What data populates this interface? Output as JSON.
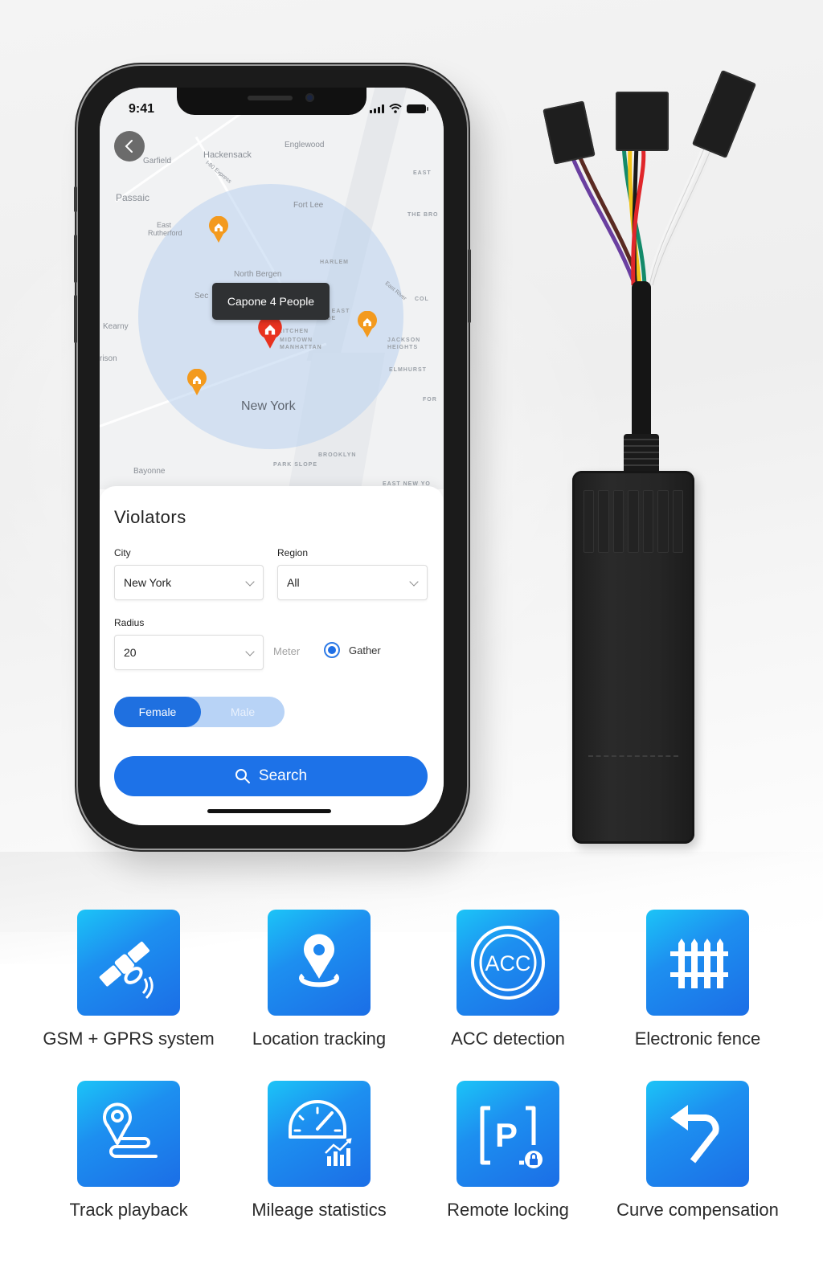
{
  "phone": {
    "status_bar": {
      "time": "9:41"
    },
    "map": {
      "labels": {
        "hackensack": "Hackensack",
        "englewood": "Englewood",
        "garfield": "Garfield",
        "express": "I-80 Express",
        "passaic": "Passaic",
        "fort_lee": "Fort Lee",
        "east": "EAST",
        "the_bronx": "THE BRO",
        "east_rutherford": "East Rutherford",
        "harlem": "HARLEM",
        "north_bergen": "North Bergen",
        "secaucus": "Sec",
        "east_river": "East River",
        "co": "COL",
        "kearny": "Kearny",
        "upper_east_side": "UPPER EAST SIDE",
        "hells_kitchen": "KITCHEN",
        "midtown": "MIDTOWN MANHATTAN",
        "jackson_heights": "JACKSON HEIGHTS",
        "harrison": "rison",
        "elmhurst": "ELMHURST",
        "new_york": "New York",
        "forest": "FOR",
        "brooklyn": "BROOKLYN",
        "park_slope": "PARK SLOPE",
        "bayonne": "Bayonne",
        "east_new_york": "EAST NEW YO"
      },
      "tooltip": "Capone  4 People"
    },
    "form": {
      "title": "Violators",
      "city": {
        "label": "City",
        "value": "New York"
      },
      "region": {
        "label": "Region",
        "value": "All"
      },
      "radius": {
        "label": "Radius",
        "value": "20",
        "unit": "Meter"
      },
      "gather": {
        "label": "Gather",
        "checked": true
      },
      "gender_toggle": {
        "options": [
          "Female",
          "Male"
        ],
        "selected": "Female"
      },
      "search_button": "Search"
    }
  },
  "features": [
    {
      "label": "GSM + GPRS system",
      "icon": "satellite-icon"
    },
    {
      "label": "Location tracking",
      "icon": "location-pin-icon"
    },
    {
      "label": "ACC detection",
      "icon": "acc-icon"
    },
    {
      "label": "Electronic fence",
      "icon": "fence-icon"
    },
    {
      "label": "Track playback",
      "icon": "track-route-icon"
    },
    {
      "label": "Mileage statistics",
      "icon": "speedometer-chart-icon"
    },
    {
      "label": "Remote locking",
      "icon": "parking-lock-icon"
    },
    {
      "label": "Curve compensation",
      "icon": "turn-arrow-icon"
    }
  ],
  "colors": {
    "accent_blue": "#1d72e8",
    "tile_gradient_start": "#1cc4f7",
    "tile_gradient_end": "#1b6ee6",
    "pin_orange": "#f39a1e",
    "pin_red": "#e8321f"
  }
}
